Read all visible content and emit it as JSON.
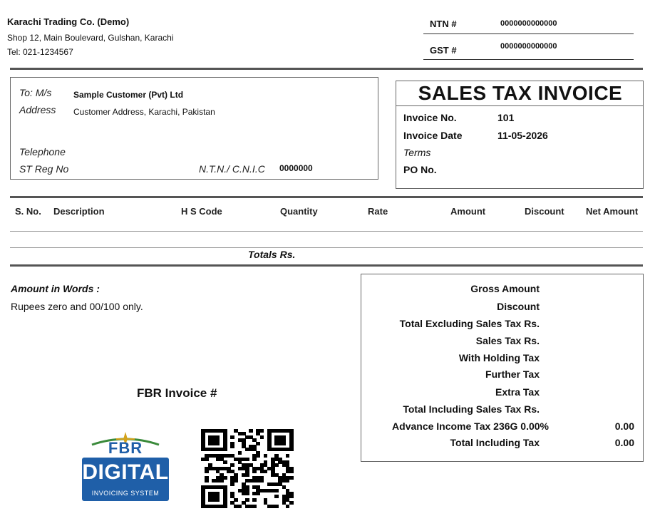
{
  "company": {
    "name": "Karachi Trading Co. (Demo)",
    "address": "Shop 12, Main Boulevard, Gulshan, Karachi",
    "tel": "Tel: 021-1234567"
  },
  "tax_ids": {
    "ntn_label": "NTN #",
    "ntn_value": "0000000000000",
    "gst_label": "GST #",
    "gst_value": "0000000000000"
  },
  "customer": {
    "to_label": "To: M/s",
    "name": "Sample Customer (Pvt) Ltd",
    "address_label": "Address",
    "address": "Customer Address, Karachi, Pakistan",
    "telephone_label": "Telephone",
    "st_reg_label": "ST Reg No",
    "ntn_cnic_label": "N.T.N./ C.N.I.C",
    "ntn_cnic_value": "0000000"
  },
  "invoice": {
    "title": "SALES TAX INVOICE",
    "no_label": "Invoice No.",
    "no_value": "101",
    "date_label": "Invoice Date",
    "date_value": "11-05-2026",
    "terms_label": "Terms",
    "po_label": "PO No."
  },
  "table": {
    "headers": [
      "S. No.",
      "Description",
      "H S Code",
      "Quantity",
      "Rate",
      "Amount",
      "Discount",
      "Net Amount"
    ],
    "totals_label": "Totals  Rs."
  },
  "amount_words": {
    "label": "Amount in Words :",
    "value": "Rupees zero and 00/100 only."
  },
  "fbr": {
    "invoice_label": "FBR Invoice #",
    "logo_top": "FBR",
    "logo_main": "DIGITAL",
    "logo_sub": "INVOICING SYSTEM"
  },
  "summary": {
    "gross": "Gross Amount",
    "discount": "Discount",
    "total_excl": "Total Excluding Sales Tax  Rs.",
    "sales_tax": "Sales Tax  Rs.",
    "withholding": "With Holding Tax",
    "further": "Further Tax",
    "extra": "Extra Tax",
    "total_incl_rs": "Total Including Sales Tax  Rs.",
    "advance_label": "Advance Income Tax 236G  0.00%",
    "advance_value": "0.00",
    "total_incl": "Total Including Tax",
    "total_incl_value": "0.00"
  },
  "colors": {
    "rule": "#333333",
    "fbr_blue": "#1f5fa8",
    "fbr_green": "#3a8a3a",
    "fbr_gold": "#d4a21b"
  }
}
